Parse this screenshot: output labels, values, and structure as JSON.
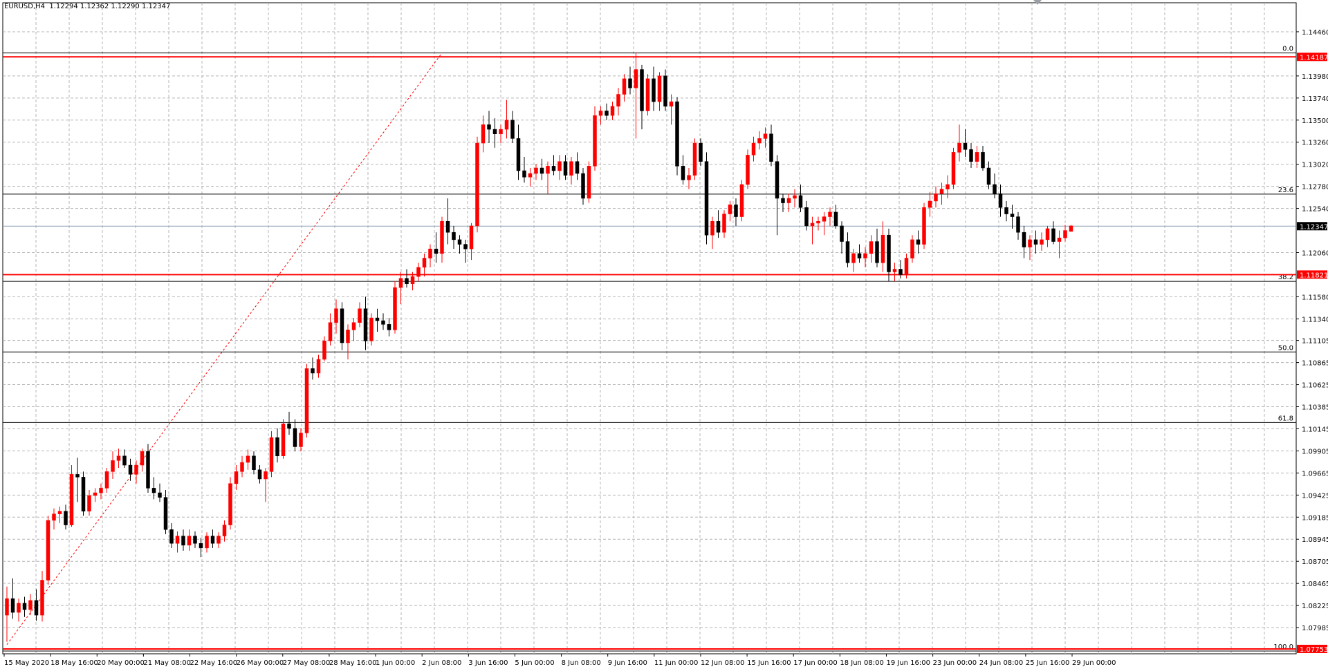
{
  "window": {
    "symbol_info": "EURUSD,H4  1.12294 1.12362 1.12290 1.12347"
  },
  "colors": {
    "bull": "#ff0000",
    "bear": "#000000",
    "grid": "#b4b4b4",
    "fib": "#000000",
    "hline": "#ff0000",
    "background": "#ffffff",
    "current_price_label": "#000000"
  },
  "chart_data": {
    "type": "candlestick",
    "symbol": "EURUSD",
    "timeframe": "H4",
    "ohlc_header": {
      "open": 1.12294,
      "high": 1.12362,
      "low": 1.1229,
      "close": 1.12347
    },
    "ylim": [
      1.077,
      1.147
    ],
    "y_ticks": [
      "1.14460",
      "1.13980",
      "1.13740",
      "1.13500",
      "1.13260",
      "1.13020",
      "1.12780",
      "1.12540",
      "1.12060",
      "1.11580",
      "1.11340",
      "1.11105",
      "1.10865",
      "1.10625",
      "1.10385",
      "1.10145",
      "1.09905",
      "1.09665",
      "1.09425",
      "1.09185",
      "1.08945",
      "1.08705",
      "1.08465",
      "1.08225",
      "1.07985"
    ],
    "x_ticks": [
      "15 May 2020",
      "18 May 16:00",
      "20 May 00:00",
      "21 May 08:00",
      "22 May 16:00",
      "26 May 00:00",
      "27 May 08:00",
      "28 May 16:00",
      "1 Jun 00:00",
      "2 Jun 08:00",
      "3 Jun 16:00",
      "5 Jun 00:00",
      "8 Jun 08:00",
      "9 Jun 16:00",
      "11 Jun 00:00",
      "12 Jun 08:00",
      "15 Jun 16:00",
      "17 Jun 00:00",
      "18 Jun 08:00",
      "19 Jun 16:00",
      "23 Jun 00:00",
      "24 Jun 08:00",
      "25 Jun 16:00",
      "29 Jun 00:00"
    ],
    "price_labels": [
      {
        "text": "1.14187",
        "value": 1.14187,
        "style": "red"
      },
      {
        "text": "1.12347",
        "value": 1.12347,
        "style": "black"
      },
      {
        "text": "1.11821",
        "value": 1.11821,
        "style": "red"
      },
      {
        "text": "1.07753",
        "value": 1.07753,
        "style": "red"
      }
    ],
    "horizontal_lines": [
      {
        "value": 1.14187,
        "color": "red"
      },
      {
        "value": 1.11821,
        "color": "red"
      },
      {
        "value": 1.07753,
        "color": "red"
      }
    ],
    "fibonacci": {
      "high": 1.1423,
      "low": 1.0773,
      "levels": [
        {
          "label": "0.0",
          "ratio": 0.0
        },
        {
          "label": "23.6",
          "ratio": 0.236
        },
        {
          "label": "38.2",
          "ratio": 0.382
        },
        {
          "label": "50.0",
          "ratio": 0.5
        },
        {
          "label": "61.8",
          "ratio": 0.618
        },
        {
          "label": "100.0",
          "ratio": 1.0
        }
      ],
      "trendline": {
        "from": [
          0,
          1.078
        ],
        "to": [
          74,
          1.1423
        ]
      }
    },
    "candles": [
      [
        1.0812,
        1.0843,
        1.0783,
        1.083
      ],
      [
        1.083,
        1.0852,
        1.0808,
        1.0815
      ],
      [
        1.0815,
        1.083,
        1.0805,
        1.0825
      ],
      [
        1.0825,
        1.0832,
        1.081,
        1.0818
      ],
      [
        1.0818,
        1.0835,
        1.0812,
        1.0828
      ],
      [
        1.0828,
        1.084,
        1.0806,
        1.0812
      ],
      [
        1.0812,
        1.086,
        1.0805,
        1.085
      ],
      [
        1.085,
        1.092,
        1.0845,
        1.0915
      ],
      [
        1.0915,
        1.0928,
        1.0905,
        1.0922
      ],
      [
        1.0922,
        1.093,
        1.0912,
        1.0925
      ],
      [
        1.0925,
        1.0932,
        1.0905,
        1.091
      ],
      [
        1.091,
        1.0975,
        1.0908,
        1.0965
      ],
      [
        1.0965,
        1.0983,
        1.0935,
        1.0962
      ],
      [
        1.0962,
        1.0968,
        1.092,
        1.0925
      ],
      [
        1.0925,
        1.0948,
        1.092,
        1.0942
      ],
      [
        1.0942,
        1.095,
        1.0935,
        1.0945
      ],
      [
        1.0945,
        1.0955,
        1.0938,
        1.095
      ],
      [
        1.095,
        1.0972,
        1.0945,
        1.0968
      ],
      [
        1.0968,
        1.099,
        1.096,
        1.098
      ],
      [
        1.098,
        1.0993,
        1.0972,
        1.0985
      ],
      [
        1.0985,
        1.0992,
        1.0972,
        1.0975
      ],
      [
        1.0975,
        1.0982,
        1.0958,
        1.0965
      ],
      [
        1.0965,
        1.098,
        1.0955,
        1.0975
      ],
      [
        1.0975,
        1.0993,
        1.0968,
        1.099
      ],
      [
        1.099,
        1.0998,
        1.0945,
        1.095
      ],
      [
        1.095,
        1.0962,
        1.0938,
        1.0945
      ],
      [
        1.0945,
        1.0955,
        1.0935,
        1.094
      ],
      [
        1.094,
        1.0948,
        1.09,
        1.0905
      ],
      [
        1.0905,
        1.0912,
        1.0885,
        1.089
      ],
      [
        1.089,
        1.0903,
        1.088,
        1.0898
      ],
      [
        1.0898,
        1.0905,
        1.0882,
        1.0888
      ],
      [
        1.0888,
        1.0905,
        1.0882,
        1.0898
      ],
      [
        1.0898,
        1.0903,
        1.0885,
        1.089
      ],
      [
        1.089,
        1.0896,
        1.0875,
        1.0885
      ],
      [
        1.0885,
        1.0902,
        1.088,
        1.0898
      ],
      [
        1.0898,
        1.0905,
        1.0885,
        1.089
      ],
      [
        1.089,
        1.0902,
        1.0885,
        1.0898
      ],
      [
        1.0898,
        1.0915,
        1.0892,
        1.091
      ],
      [
        1.091,
        1.0962,
        1.0905,
        1.0955
      ],
      [
        1.0955,
        1.0975,
        1.0948,
        1.0968
      ],
      [
        1.0968,
        1.0985,
        1.0962,
        1.0978
      ],
      [
        1.0978,
        1.0992,
        1.097,
        1.0985
      ],
      [
        1.0985,
        1.099,
        1.0965,
        1.097
      ],
      [
        1.097,
        1.0975,
        1.0955,
        1.096
      ],
      [
        1.096,
        1.0972,
        1.0935,
        1.0968
      ],
      [
        1.0968,
        1.1012,
        1.0962,
        1.1005
      ],
      [
        1.1005,
        1.1015,
        1.0978,
        1.0985
      ],
      [
        1.0985,
        1.1025,
        1.0982,
        1.102
      ],
      [
        1.102,
        1.1033,
        1.1008,
        1.1015
      ],
      [
        1.1015,
        1.1025,
        1.099,
        1.0995
      ],
      [
        1.0995,
        1.1015,
        1.099,
        1.101
      ],
      [
        1.101,
        1.1085,
        1.1005,
        1.108
      ],
      [
        1.108,
        1.1092,
        1.1068,
        1.1075
      ],
      [
        1.1075,
        1.1095,
        1.107,
        1.109
      ],
      [
        1.109,
        1.1115,
        1.1088,
        1.111
      ],
      [
        1.111,
        1.114,
        1.1105,
        1.113
      ],
      [
        1.113,
        1.1155,
        1.1118,
        1.1145
      ],
      [
        1.1145,
        1.1152,
        1.11,
        1.1108
      ],
      [
        1.1108,
        1.1128,
        1.109,
        1.1122
      ],
      [
        1.1122,
        1.1135,
        1.111,
        1.113
      ],
      [
        1.113,
        1.1152,
        1.1125,
        1.1145
      ],
      [
        1.1145,
        1.1158,
        1.11,
        1.111
      ],
      [
        1.111,
        1.114,
        1.1105,
        1.1135
      ],
      [
        1.1135,
        1.1145,
        1.112,
        1.1132
      ],
      [
        1.1132,
        1.114,
        1.1122,
        1.1128
      ],
      [
        1.1128,
        1.1135,
        1.1115,
        1.1122
      ],
      [
        1.1122,
        1.1175,
        1.1118,
        1.1168
      ],
      [
        1.1168,
        1.1185,
        1.115,
        1.1178
      ],
      [
        1.1178,
        1.1188,
        1.1168,
        1.1172
      ],
      [
        1.1172,
        1.1185,
        1.1165,
        1.118
      ],
      [
        1.118,
        1.1195,
        1.1175,
        1.119
      ],
      [
        1.119,
        1.1205,
        1.118,
        1.12
      ],
      [
        1.12,
        1.1215,
        1.119,
        1.121
      ],
      [
        1.121,
        1.1228,
        1.1195,
        1.1205
      ],
      [
        1.1205,
        1.1245,
        1.1195,
        1.124
      ],
      [
        1.124,
        1.1265,
        1.1215,
        1.1228
      ],
      [
        1.1228,
        1.1235,
        1.121,
        1.122
      ],
      [
        1.122,
        1.1225,
        1.1205,
        1.1215
      ],
      [
        1.1215,
        1.122,
        1.1195,
        1.121
      ],
      [
        1.121,
        1.1238,
        1.1198,
        1.1235
      ],
      [
        1.1235,
        1.1332,
        1.1228,
        1.1325
      ],
      [
        1.1325,
        1.1355,
        1.1315,
        1.1345
      ],
      [
        1.1345,
        1.136,
        1.1325,
        1.134
      ],
      [
        1.134,
        1.1352,
        1.132,
        1.1335
      ],
      [
        1.1335,
        1.1345,
        1.1325,
        1.134
      ],
      [
        1.134,
        1.1372,
        1.133,
        1.135
      ],
      [
        1.135,
        1.136,
        1.1325,
        1.133
      ],
      [
        1.133,
        1.1345,
        1.1285,
        1.1295
      ],
      [
        1.1295,
        1.131,
        1.1282,
        1.1288
      ],
      [
        1.1288,
        1.1298,
        1.1278,
        1.1292
      ],
      [
        1.1292,
        1.1302,
        1.1285,
        1.1298
      ],
      [
        1.1298,
        1.1308,
        1.1285,
        1.1292
      ],
      [
        1.1292,
        1.1305,
        1.127,
        1.13
      ],
      [
        1.13,
        1.1312,
        1.129,
        1.1295
      ],
      [
        1.1295,
        1.1312,
        1.1285,
        1.1305
      ],
      [
        1.1305,
        1.1312,
        1.1285,
        1.129
      ],
      [
        1.129,
        1.131,
        1.128,
        1.1305
      ],
      [
        1.1305,
        1.1315,
        1.1285,
        1.1292
      ],
      [
        1.1292,
        1.1298,
        1.1258,
        1.1265
      ],
      [
        1.1265,
        1.1305,
        1.126,
        1.13
      ],
      [
        1.13,
        1.1365,
        1.1295,
        1.1355
      ],
      [
        1.1355,
        1.1365,
        1.1345,
        1.136
      ],
      [
        1.136,
        1.1368,
        1.135,
        1.1355
      ],
      [
        1.1355,
        1.137,
        1.135,
        1.1365
      ],
      [
        1.1365,
        1.1385,
        1.1355,
        1.1378
      ],
      [
        1.1378,
        1.14,
        1.137,
        1.1395
      ],
      [
        1.1395,
        1.1408,
        1.1378,
        1.1385
      ],
      [
        1.1385,
        1.1423,
        1.133,
        1.1405
      ],
      [
        1.1405,
        1.141,
        1.134,
        1.136
      ],
      [
        1.136,
        1.14,
        1.1355,
        1.1395
      ],
      [
        1.1395,
        1.1408,
        1.136,
        1.137
      ],
      [
        1.137,
        1.1402,
        1.136,
        1.1398
      ],
      [
        1.1398,
        1.1405,
        1.136,
        1.1365
      ],
      [
        1.1365,
        1.1378,
        1.1345,
        1.137
      ],
      [
        1.137,
        1.1375,
        1.129,
        1.13
      ],
      [
        1.13,
        1.1312,
        1.128,
        1.1285
      ],
      [
        1.1285,
        1.1298,
        1.1275,
        1.129
      ],
      [
        1.129,
        1.133,
        1.1285,
        1.1325
      ],
      [
        1.1325,
        1.133,
        1.13,
        1.1305
      ],
      [
        1.1305,
        1.1315,
        1.1215,
        1.1225
      ],
      [
        1.1225,
        1.1245,
        1.121,
        1.124
      ],
      [
        1.124,
        1.1252,
        1.1222,
        1.1228
      ],
      [
        1.1228,
        1.1252,
        1.1222,
        1.1248
      ],
      [
        1.1248,
        1.1262,
        1.124,
        1.1258
      ],
      [
        1.1258,
        1.1265,
        1.1235,
        1.1245
      ],
      [
        1.1245,
        1.1285,
        1.124,
        1.128
      ],
      [
        1.128,
        1.1318,
        1.1275,
        1.1312
      ],
      [
        1.1312,
        1.1332,
        1.1305,
        1.1325
      ],
      [
        1.1325,
        1.1338,
        1.1318,
        1.133
      ],
      [
        1.133,
        1.1342,
        1.132,
        1.1335
      ],
      [
        1.1335,
        1.1345,
        1.13,
        1.1305
      ],
      [
        1.1305,
        1.1312,
        1.1225,
        1.1265
      ],
      [
        1.1265,
        1.127,
        1.125,
        1.126
      ],
      [
        1.126,
        1.127,
        1.125,
        1.1265
      ],
      [
        1.1265,
        1.1275,
        1.1255,
        1.1268
      ],
      [
        1.1268,
        1.128,
        1.125,
        1.1255
      ],
      [
        1.1255,
        1.1262,
        1.123,
        1.1235
      ],
      [
        1.1235,
        1.1245,
        1.1215,
        1.1238
      ],
      [
        1.1238,
        1.1245,
        1.123,
        1.124
      ],
      [
        1.124,
        1.125,
        1.1225,
        1.1245
      ],
      [
        1.1245,
        1.1255,
        1.1235,
        1.125
      ],
      [
        1.125,
        1.1258,
        1.1232,
        1.1235
      ],
      [
        1.1235,
        1.124,
        1.1205,
        1.1218
      ],
      [
        1.1218,
        1.1228,
        1.119,
        1.1195
      ],
      [
        1.1195,
        1.121,
        1.1185,
        1.1205
      ],
      [
        1.1205,
        1.1215,
        1.1195,
        1.12
      ],
      [
        1.12,
        1.1212,
        1.119,
        1.1205
      ],
      [
        1.1205,
        1.1225,
        1.1195,
        1.1218
      ],
      [
        1.1218,
        1.1232,
        1.119,
        1.1195
      ],
      [
        1.1195,
        1.124,
        1.1185,
        1.1225
      ],
      [
        1.1225,
        1.1232,
        1.1175,
        1.1185
      ],
      [
        1.1185,
        1.1195,
        1.1175,
        1.1188
      ],
      [
        1.1188,
        1.1198,
        1.1178,
        1.1182
      ],
      [
        1.1182,
        1.1205,
        1.1178,
        1.12
      ],
      [
        1.12,
        1.1225,
        1.1195,
        1.122
      ],
      [
        1.122,
        1.123,
        1.1205,
        1.1215
      ],
      [
        1.1215,
        1.126,
        1.121,
        1.1255
      ],
      [
        1.1255,
        1.1272,
        1.1245,
        1.1262
      ],
      [
        1.1262,
        1.1278,
        1.1255,
        1.127
      ],
      [
        1.127,
        1.1282,
        1.1258,
        1.1275
      ],
      [
        1.1275,
        1.129,
        1.1265,
        1.128
      ],
      [
        1.128,
        1.132,
        1.1275,
        1.1315
      ],
      [
        1.1315,
        1.1345,
        1.1305,
        1.1325
      ],
      [
        1.1325,
        1.134,
        1.131,
        1.1318
      ],
      [
        1.1318,
        1.1325,
        1.1298,
        1.1305
      ],
      [
        1.1305,
        1.1322,
        1.1298,
        1.1315
      ],
      [
        1.1315,
        1.1322,
        1.1295,
        1.1298
      ],
      [
        1.1298,
        1.1305,
        1.1275,
        1.128
      ],
      [
        1.128,
        1.1292,
        1.1265,
        1.127
      ],
      [
        1.127,
        1.128,
        1.1245,
        1.1255
      ],
      [
        1.1255,
        1.1262,
        1.124,
        1.1248
      ],
      [
        1.1248,
        1.1258,
        1.1232,
        1.1245
      ],
      [
        1.1245,
        1.125,
        1.122,
        1.1228
      ],
      [
        1.1228,
        1.1235,
        1.12,
        1.1212
      ],
      [
        1.1212,
        1.1225,
        1.1198,
        1.122
      ],
      [
        1.122,
        1.123,
        1.1205,
        1.1215
      ],
      [
        1.1215,
        1.1228,
        1.1208,
        1.122
      ],
      [
        1.122,
        1.1235,
        1.1212,
        1.1232
      ],
      [
        1.1232,
        1.124,
        1.1215,
        1.1218
      ],
      [
        1.1218,
        1.123,
        1.12,
        1.1222
      ],
      [
        1.1222,
        1.1236,
        1.1218,
        1.123
      ],
      [
        1.1229,
        1.1236,
        1.1229,
        1.1235
      ]
    ]
  }
}
